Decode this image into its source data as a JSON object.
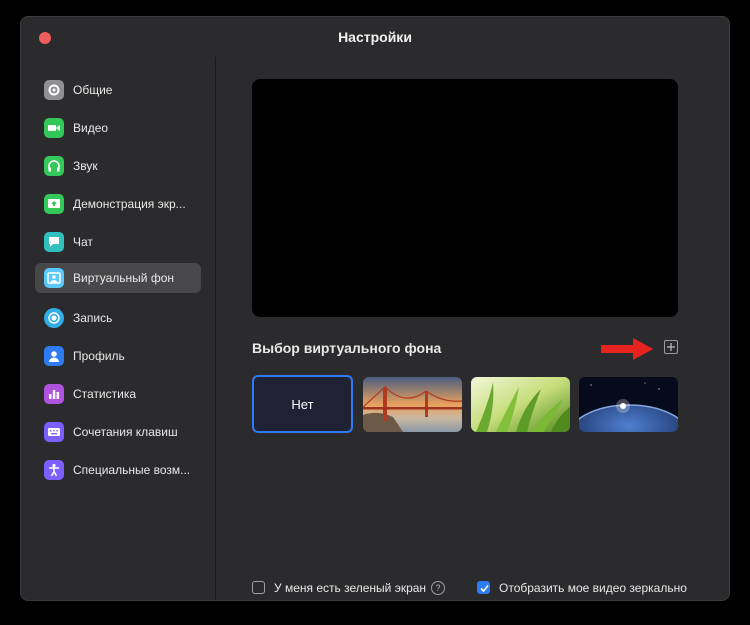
{
  "window": {
    "title": "Настройки"
  },
  "sidebar": {
    "items": [
      {
        "label": "Общие",
        "icon": "gear-icon",
        "color": "#8e8e93"
      },
      {
        "label": "Видео",
        "icon": "video-camera-icon",
        "color": "#34c759"
      },
      {
        "label": "Звук",
        "icon": "headphones-icon",
        "color": "#34c759"
      },
      {
        "label": "Демонстрация экр...",
        "icon": "share-screen-icon",
        "color": "#34c759"
      },
      {
        "label": "Чат",
        "icon": "chat-bubble-icon",
        "color": "#30c0c0"
      },
      {
        "label": "Виртуальный фон",
        "icon": "virtual-background-icon",
        "color": "#5ac8fa",
        "active": true
      },
      {
        "label": "Запись",
        "icon": "record-icon",
        "color": "#32ade6"
      },
      {
        "label": "Профиль",
        "icon": "profile-icon",
        "color": "#2e7bf3"
      },
      {
        "label": "Статистика",
        "icon": "statistics-icon",
        "color": "#af52de"
      },
      {
        "label": "Сочетания клавиш",
        "icon": "keyboard-icon",
        "color": "#7d5fff"
      },
      {
        "label": "Специальные возм...",
        "icon": "accessibility-icon",
        "color": "#7d5fff"
      }
    ]
  },
  "main": {
    "section_title": "Выбор виртуального фона",
    "backgrounds": [
      {
        "label": "Нет",
        "selected": true
      },
      {
        "icon": "golden-gate-bridge-image"
      },
      {
        "icon": "grass-image"
      },
      {
        "icon": "earth-from-space-image"
      }
    ],
    "green_screen_label": "У меня есть зеленый экран",
    "help_symbol": "?",
    "mirror_label": "Отобразить мое видео зеркально",
    "mirror_checked": true
  },
  "colors": {
    "accent": "#2e7bf3",
    "arrow": "#e8231f"
  }
}
